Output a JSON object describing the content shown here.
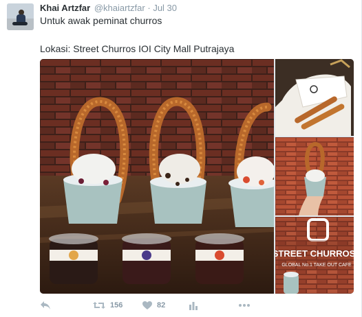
{
  "tweet": {
    "author_name": "Khai Artzfar",
    "author_handle": "@khaiartzfar",
    "separator": "·",
    "timestamp": "Jul 30",
    "text_line_1": "Untuk awak peminat churros",
    "text_line_2": "Lokasi: Street Churros IOI City Mall Putrajaya"
  },
  "media": {
    "photos": [
      {
        "role": "main",
        "subject": "three churros cups on wooden board with sauce pots"
      },
      {
        "role": "side",
        "subject": "churros sticks in paper wrap"
      },
      {
        "role": "side",
        "subject": "churros cup held against brick wall"
      },
      {
        "role": "side",
        "subject": "street churros shop sign"
      }
    ],
    "shop_sign_text": "STREET CHURROS",
    "shop_sign_subtext": "GLOBAL No.1 TAKE OUT CAFE"
  },
  "actions": {
    "reply_icon": "reply-icon",
    "retweet_icon": "retweet-icon",
    "retweet_count": "156",
    "like_icon": "heart-icon",
    "like_count": "82",
    "analytics_icon": "analytics-icon",
    "more_icon": "more-icon"
  },
  "colors": {
    "text": "#292f33",
    "muted": "#8899a6",
    "divider": "#e1e8ed"
  }
}
